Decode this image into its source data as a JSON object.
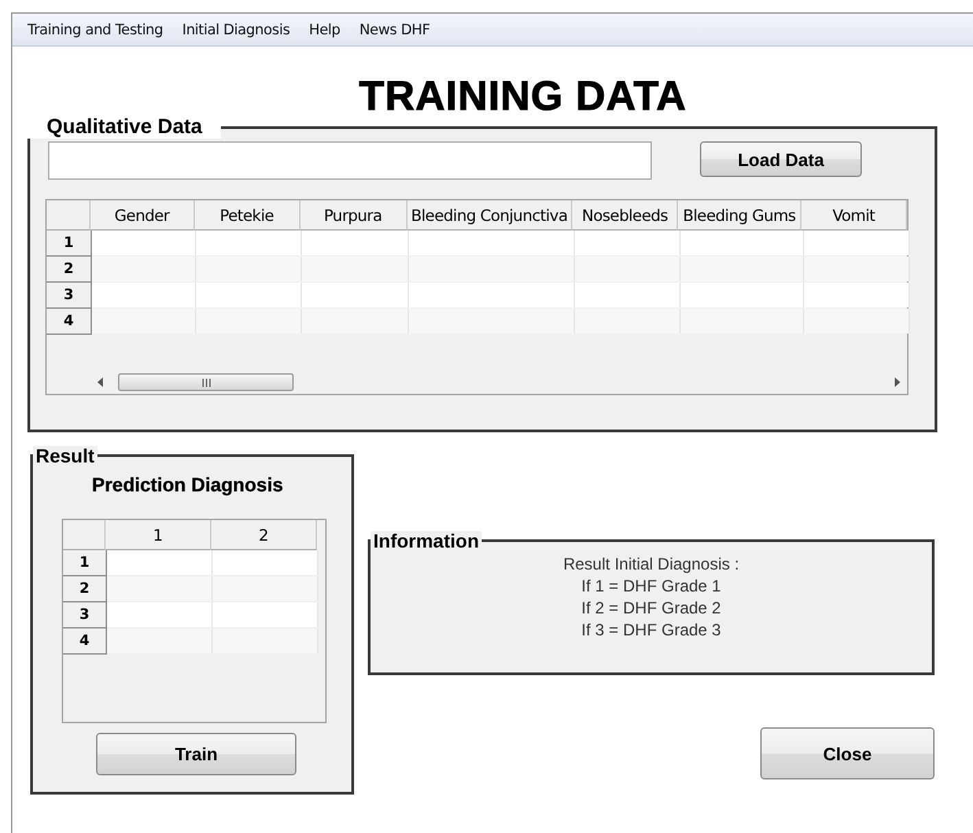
{
  "menu": [
    "Training and Testing",
    "Initial Diagnosis",
    "Help",
    "News DHF"
  ],
  "title": "TRAINING DATA",
  "qualitative": {
    "title": "Qualitative Data",
    "load_button": "Load Data",
    "table": {
      "columns": [
        "Gender",
        "Petekie",
        "Purpura",
        "Bleeding Conjunctiva",
        "Nosebleeds",
        "Bleeding Gums",
        "Vomit"
      ],
      "row_headers": [
        "1",
        "2",
        "3",
        "4"
      ]
    }
  },
  "result": {
    "title": "Result",
    "subtitle": "Prediction Diagnosis",
    "table": {
      "columns": [
        "1",
        "2"
      ],
      "row_headers": [
        "1",
        "2",
        "3",
        "4"
      ]
    },
    "train_button": "Train"
  },
  "information": {
    "title": "Information",
    "lines": [
      "Result Initial Diagnosis :",
      "If 1 = DHF Grade 1",
      "If 2 = DHF Grade 2",
      "If 3 = DHF Grade 3"
    ]
  },
  "close_button": "Close"
}
